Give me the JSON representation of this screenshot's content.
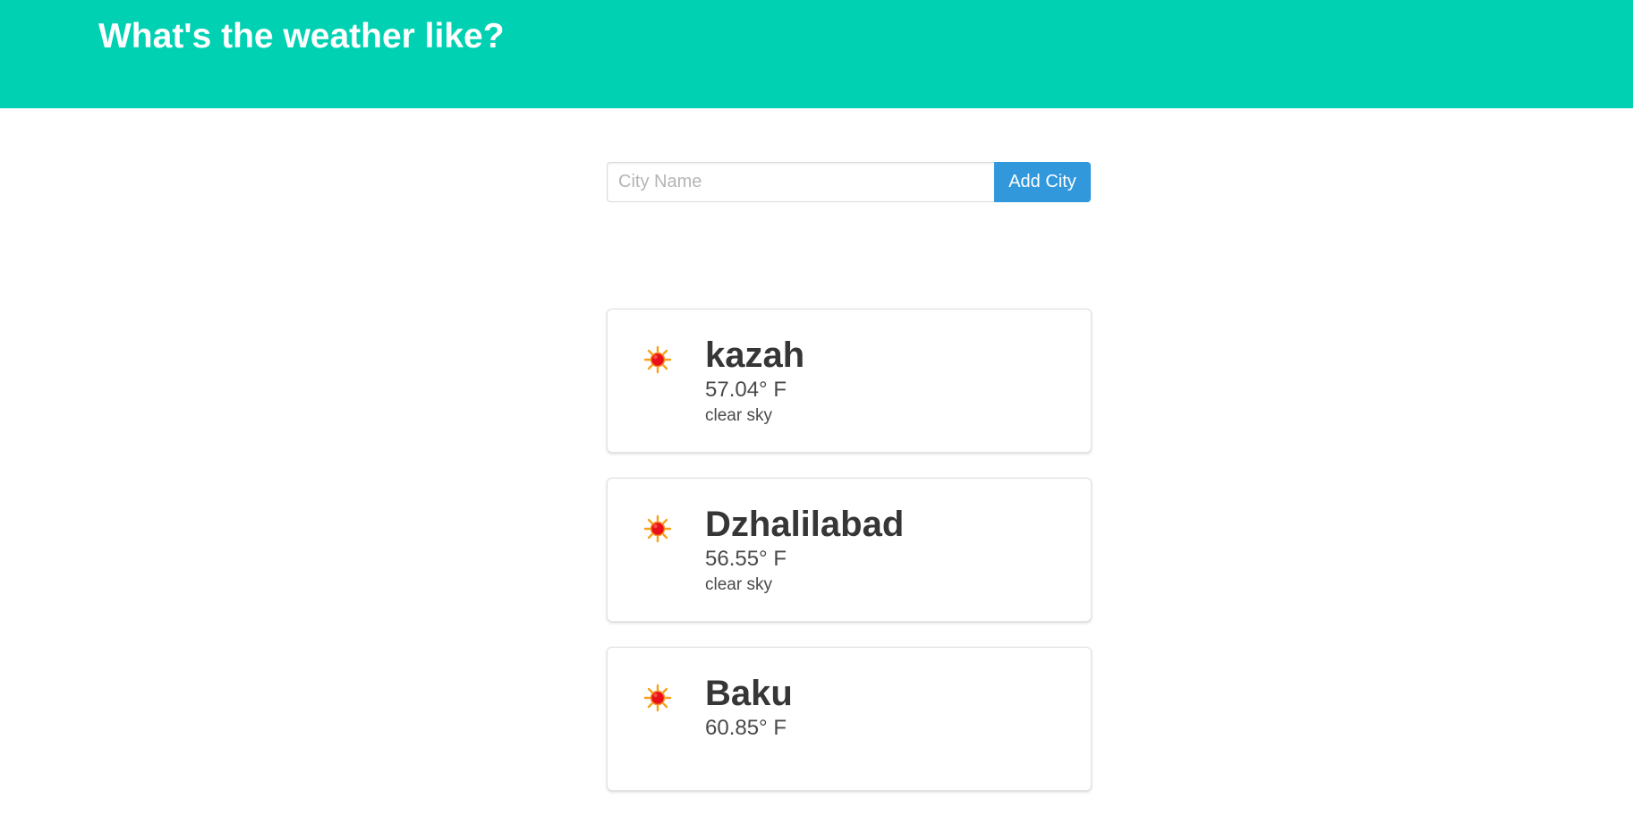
{
  "header": {
    "title": "What's the weather like?"
  },
  "form": {
    "input_placeholder": "City Name",
    "input_value": "",
    "button_label": "Add City"
  },
  "cities": [
    {
      "name": "kazah",
      "temperature": "57.04° F",
      "description": "clear sky",
      "icon": "sun-icon"
    },
    {
      "name": "Dzhalilabad",
      "temperature": "56.55° F",
      "description": "clear sky",
      "icon": "sun-icon"
    },
    {
      "name": "Baku",
      "temperature": "60.85° F",
      "description": "",
      "icon": "sun-icon"
    }
  ],
  "colors": {
    "hero": "#00d1b2",
    "button": "#3298dc",
    "sun_core": "#e8111a",
    "sun_rays": "#f5a21b"
  }
}
